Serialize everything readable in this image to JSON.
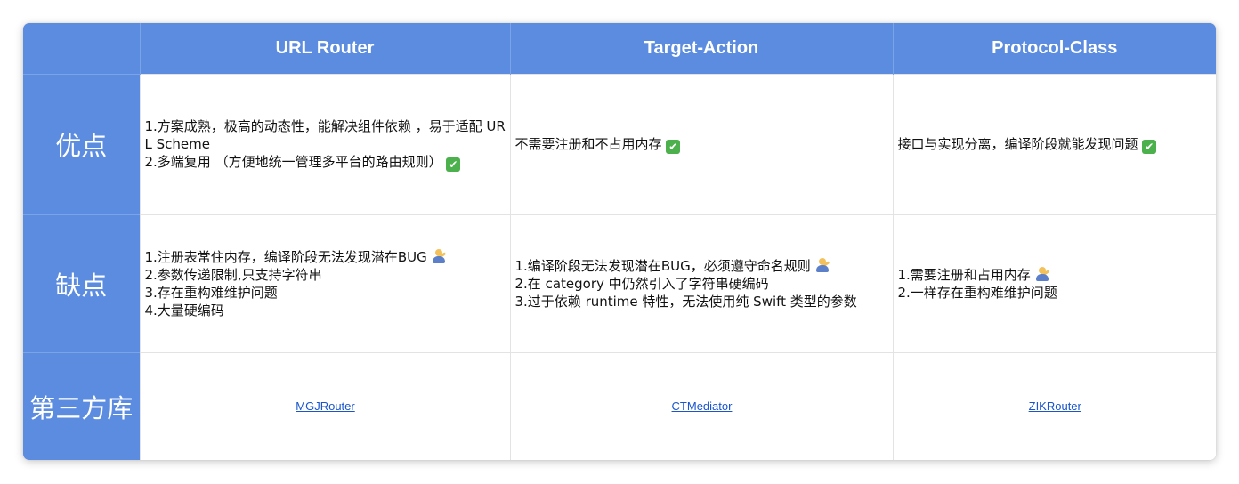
{
  "table": {
    "columns": [
      "URL Router",
      "Target-Action",
      "Protocol-Class"
    ],
    "rows": {
      "pros": {
        "label": "优点",
        "cells": [
          [
            "1.方案成熟，极高的动态性，能解决组件依赖 ，易于适配 URL Scheme",
            "2.多端复用 （方便地统一管理多平台的路由规则）"
          ],
          [
            "不需要注册和不占用内存"
          ],
          [
            "接口与实现分离，编译阶段就能发现问题"
          ]
        ]
      },
      "cons": {
        "label": "缺点",
        "cells": [
          [
            "1.注册表常住内存，编译阶段无法发现潜在BUG",
            "2.参数传递限制,只支持字符串",
            "3.存在重构难维护问题",
            "4.大量硬编码"
          ],
          [
            "1.编译阶段无法发现潜在BUG，必须遵守命名规则",
            "2.在 category 中仍然引入了字符串硬编码",
            "3.过于依赖 runtime 特性，无法使用纯 Swift 类型的参数"
          ],
          [
            "1.需要注册和占用内存",
            "2.一样存在重构难维护问题"
          ]
        ]
      },
      "libs": {
        "label": "第三方库",
        "links": [
          "MGJRouter",
          "CTMediator",
          "ZIKRouter"
        ]
      }
    }
  },
  "icons": {
    "check": "white-check-mark-icon",
    "shrug": "person-shrugging-icon"
  },
  "colors": {
    "header_bg": "#5b8ce0",
    "header_text": "#ffffff",
    "link": "#1a55cc",
    "check": "#4cb04c"
  }
}
